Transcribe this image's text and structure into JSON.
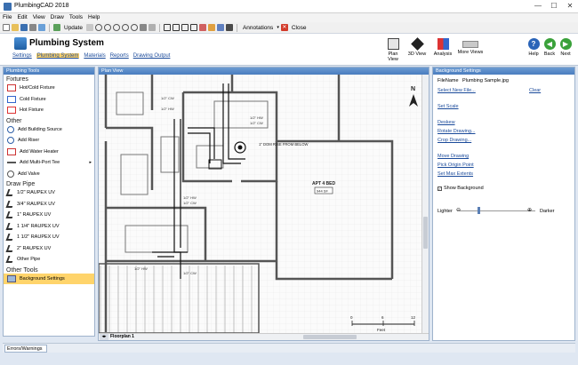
{
  "window": {
    "title": "PlumbingCAD 2018",
    "controls": [
      "—",
      "☐",
      "✕"
    ]
  },
  "menu": [
    "File",
    "Edit",
    "View",
    "Draw",
    "Tools",
    "Help"
  ],
  "toolbar": {
    "update_label": "Update",
    "annotations_label": "Annotations",
    "close_label": "Close"
  },
  "ribbon": {
    "title": "Plumbing System",
    "tabs": [
      "Settings",
      "Plumbing System",
      "Materials",
      "Reports",
      "Drawing Output"
    ],
    "buttons": [
      "Plan View",
      "3D View",
      "Analysis",
      "More Views",
      "Help",
      "Back",
      "Next"
    ]
  },
  "left_panel": {
    "header": "Plumbing Tools",
    "sections": [
      {
        "title": "Fixtures",
        "items": [
          "Hot/Cold Fixture",
          "Cold Fixture",
          "Hot Fixture"
        ]
      },
      {
        "title": "Other",
        "items": [
          "Add Building Source",
          "Add Riser",
          "Add Water Heater",
          "Add Multi-Port Tee",
          "Add Valve"
        ]
      },
      {
        "title": "Draw Pipe",
        "items": [
          "1/2\" RAUPEX UV",
          "3/4\" RAUPEX UV",
          "1\" RAUPEX UV",
          "1 1/4\" RAUPEX UV",
          "1 1/2\" RAUPEX UV",
          "2\" RAUPEX UV",
          "Other Pipe"
        ]
      },
      {
        "title": "Other Tools",
        "items": [
          "Background Settings"
        ]
      }
    ],
    "selected_item": "Background Settings"
  },
  "center_panel": {
    "header": "Plan View",
    "room_label": "APT 4 BED",
    "room_area": "944 SF",
    "riser_note": "1\" DOM RISE FROM BELOW",
    "scale_ticks": [
      "0",
      "6",
      "12"
    ],
    "scale_unit": "Feet",
    "sheet_tab": "Floorplan 1",
    "compass": "N"
  },
  "right_panel": {
    "header": "Background Settings",
    "filename_label": "FileName",
    "filename_value": "Plumbing Sample.jpg",
    "select_new_file": "Select New File...",
    "clear": "Clear",
    "set_scale": "Set Scale",
    "deskew": "Deskew",
    "rotate_drawing": "Rotate Drawing...",
    "crop_drawing": "Crop Drawing...",
    "move_drawing": "Move Drawing",
    "pick_origin": "Pick Origin Point",
    "set_max_extents": "Set Max Extents",
    "show_background": "Show Background",
    "show_background_checked": true,
    "lighter": "Lighter",
    "darker": "Darker"
  },
  "bottom": {
    "tab": "Errors/Warnings"
  }
}
